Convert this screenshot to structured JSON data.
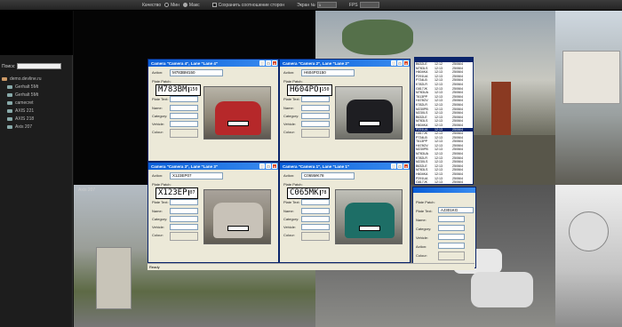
{
  "toolbar": {
    "quality_label": "Качество",
    "min_label": "Мин",
    "max_label": "Макс",
    "aspect_label": "Сохранить соотношение сторон",
    "screen_label": "Экран №",
    "screen_value": "1",
    "fps_label": "FPS"
  },
  "sidebar": {
    "search_label": "Поиск:",
    "tree": [
      "demo.devline.ru",
      "Gerhalt 5Mt",
      "Gerhalt 5Mt",
      "camecret",
      "AXIS 221",
      "AXIS 218",
      "Axis 207"
    ],
    "cam_label": "Axis 207"
  },
  "cards": [
    {
      "title": "Camera \"Camera 4\", Lane \"Lane 4\"",
      "action_value": "M783BM150",
      "plate_main": "M783BM",
      "plate_region": "150"
    },
    {
      "title": "Camera \"Camera 2\", Lane \"Lane 2\"",
      "action_value": "H604PO150",
      "plate_main": "H604PO",
      "plate_region": "150"
    },
    {
      "title": "Camera \"Camera 3\", Lane \"Lane 3\"",
      "action_value": "X123EP07",
      "plate_main": "X123EP",
      "plate_region": "07"
    },
    {
      "title": "Camera \"Camera 1\", Lane \"Lane 1\"",
      "action_value": "C065MK78",
      "plate_main": "C065MK",
      "plate_region": "78"
    }
  ],
  "card_labels": {
    "action": "Action:",
    "plate_patch": "Plate Patch:",
    "plate_text": "Plate Text:",
    "name": "Name:",
    "category": "Category:",
    "vehicle": "Vehicle:",
    "colour": "Colour:"
  },
  "list": {
    "rows": [
      [
        "B632LE",
        "12:12",
        "25/06/4"
      ],
      [
        "M783LS",
        "12:13",
        "25/06/4"
      ],
      [
        "H604KA",
        "12:13",
        "25/06/4"
      ],
      [
        "P291UA",
        "12:13",
        "25/06/4"
      ],
      [
        "P734LB",
        "12:13",
        "25/06/4"
      ],
      [
        "K782LR",
        "12:13",
        "25/06/4"
      ],
      [
        "G817JK",
        "12:13",
        "25/06/4"
      ],
      [
        "M783UA",
        "12:13",
        "25/06/4"
      ],
      [
        "T613PP",
        "12:13",
        "25/06/4"
      ],
      [
        "H478OV",
        "12:13",
        "25/06/4"
      ],
      [
        "K782LR",
        "12:13",
        "25/06/4"
      ],
      [
        "M230PB",
        "12:13",
        "25/06/4"
      ],
      [
        "M230LS",
        "12:13",
        "25/06/4"
      ],
      [
        "B632LE",
        "12:13",
        "25/06/4"
      ],
      [
        "M783LS",
        "12:13",
        "25/06/4"
      ],
      [
        "H604KA",
        "12:13",
        "25/06/4"
      ],
      [
        "P291UA",
        "12:13",
        "25/06/4"
      ],
      [
        "G817JK",
        "12:13",
        "25/06/4"
      ],
      [
        "P734LB",
        "12:13",
        "25/06/4"
      ],
      [
        "T613PP",
        "12:13",
        "25/06/4"
      ],
      [
        "H478OV",
        "12:13",
        "25/06/4"
      ],
      [
        "M230PB",
        "12:13",
        "25/06/4"
      ],
      [
        "M783UA",
        "12:13",
        "25/06/4"
      ],
      [
        "K782LR",
        "12:13",
        "25/06/4"
      ],
      [
        "M230LS",
        "12:13",
        "25/06/4"
      ],
      [
        "B632LE",
        "12:13",
        "25/06/4"
      ],
      [
        "M783LS",
        "12:13",
        "25/06/4"
      ],
      [
        "H604KA",
        "12:13",
        "25/06/4"
      ],
      [
        "P291UA",
        "12:13",
        "25/06/4"
      ],
      [
        "G817JK",
        "12:13",
        "25/06/4"
      ]
    ]
  },
  "detail": {
    "plate_patch": "Plate Patch:",
    "plate_text": "Plate Text:",
    "plate_value": "AJ301KG",
    "name": "Name:",
    "category": "Category:",
    "vehicle": "Vehicle:",
    "action": "Action:",
    "colour": "Colour:"
  },
  "status": "Ready"
}
